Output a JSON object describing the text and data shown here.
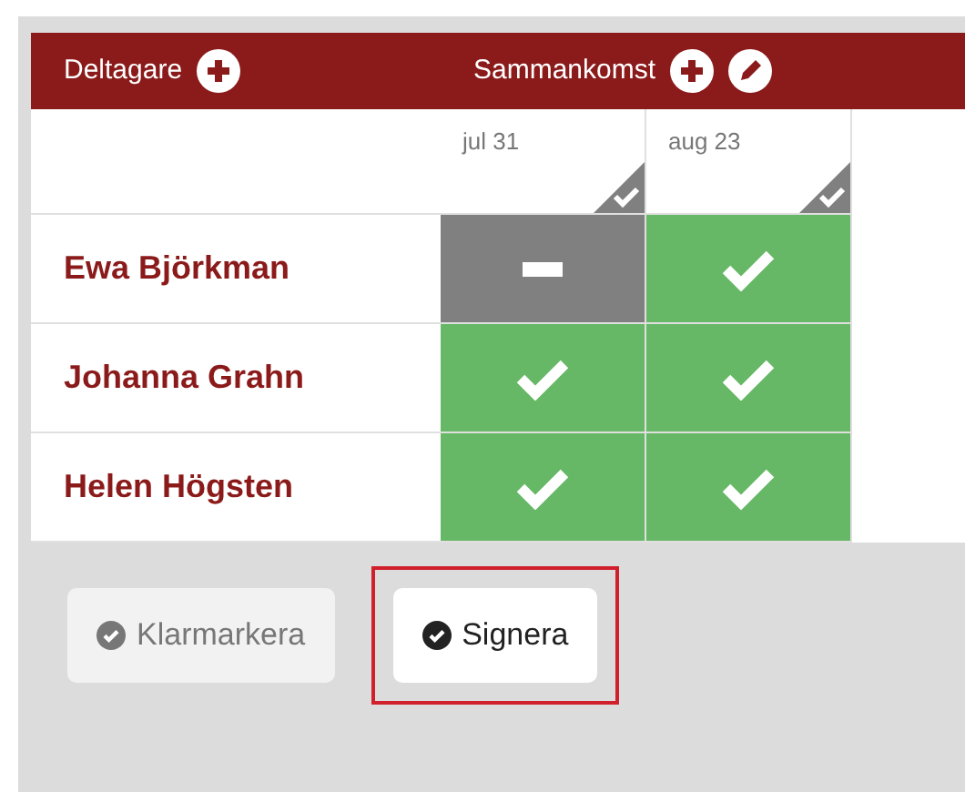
{
  "header": {
    "participants_label": "Deltagare",
    "meeting_label": "Sammankomst"
  },
  "dates": [
    "jul 31",
    "aug 23"
  ],
  "rows": [
    {
      "name": "Ewa Björkman",
      "cells": [
        {
          "kind": "dash"
        },
        {
          "kind": "check"
        }
      ]
    },
    {
      "name": "Johanna Grahn",
      "cells": [
        {
          "kind": "check"
        },
        {
          "kind": "check"
        }
      ]
    },
    {
      "name": "Helen Högsten",
      "cells": [
        {
          "kind": "check"
        },
        {
          "kind": "check"
        }
      ]
    }
  ],
  "buttons": [
    {
      "label": "Klarmarkera",
      "disabled": true,
      "highlighted": false
    },
    {
      "label": "Signera",
      "disabled": false,
      "highlighted": true
    }
  ]
}
